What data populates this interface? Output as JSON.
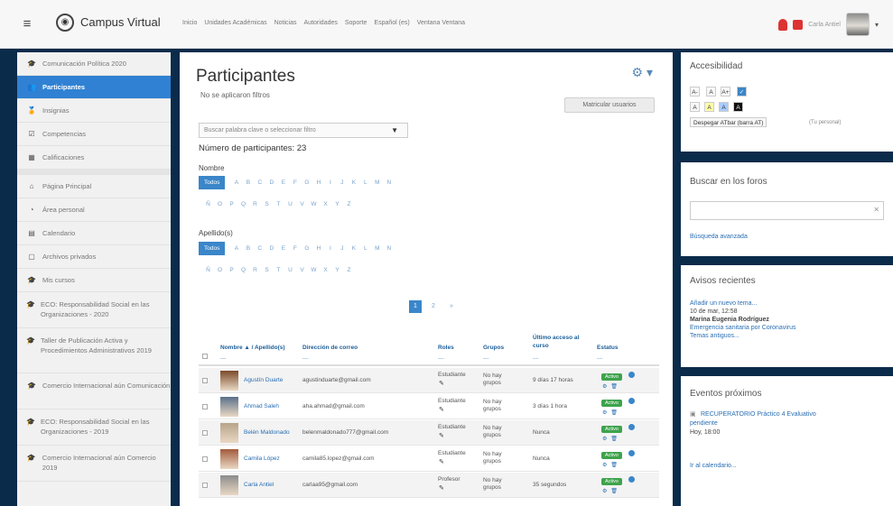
{
  "navbar": {
    "menu_icon": "hamburger-icon",
    "brand": "Campus Virtual",
    "links": [
      "Inicio",
      "Unidades Académicas",
      "Noticias",
      "Autoridades",
      "Soporte",
      "Español (es)",
      "Ventana Ventana"
    ],
    "user_name": "Carla Antiel",
    "chevron": "▾"
  },
  "drawer": {
    "items": [
      {
        "label": "Comunicación Política 2020",
        "icon": "graduation-cap-icon",
        "glyph": "🎓",
        "active": false
      },
      {
        "label": "Participantes",
        "icon": "users-icon",
        "glyph": "👥",
        "active": true
      },
      {
        "label": "Insignias",
        "icon": "badge-icon",
        "glyph": "🏅",
        "active": false
      },
      {
        "label": "Competencias",
        "icon": "competencies-icon",
        "glyph": "☑",
        "active": false
      },
      {
        "label": "Calificaciones",
        "icon": "grades-icon",
        "glyph": "▦",
        "active": false
      }
    ],
    "items2": [
      {
        "label": "Página Principal",
        "icon": "home-icon",
        "glyph": "⌂"
      },
      {
        "label": "Área personal",
        "icon": "dashboard-icon",
        "glyph": "◔"
      },
      {
        "label": "Calendario",
        "icon": "calendar-icon",
        "glyph": "▤"
      },
      {
        "label": "Archivos privados",
        "icon": "file-icon",
        "glyph": "▢"
      },
      {
        "label": "Mis cursos",
        "icon": "courses-icon",
        "glyph": "🎓"
      }
    ],
    "courses": [
      "ECO: Responsabilidad Social en las Organizaciones - 2020",
      "Taller de Publicación Activa y Procedimientos Administrativos 2019",
      "Comercio Internacional aún Comunicación",
      "ECO: Responsabilidad Social en las Organizaciones - 2019",
      "Comercio Internacional aún Comercio 2019"
    ]
  },
  "main": {
    "title": "Participantes",
    "filter_note": "No se aplicaron filtros",
    "enroll_button": "Matricular usuarios",
    "keyword_placeholder": "Buscar palabra clave o seleccionar filtro",
    "count": "Número de participantes: 23",
    "first_name_label": "Nombre",
    "last_name_label": "Apellido(s)",
    "all_label": "Todos",
    "letters_row1": [
      "A",
      "B",
      "C",
      "D",
      "E",
      "F",
      "G",
      "H",
      "I",
      "J",
      "K",
      "L",
      "M",
      "N"
    ],
    "letters_row2": [
      "Ñ",
      "O",
      "P",
      "Q",
      "R",
      "S",
      "T",
      "U",
      "V",
      "W",
      "X",
      "Y",
      "Z"
    ],
    "pages": [
      "1",
      "2",
      "»"
    ],
    "table": {
      "headers": {
        "name": "Nombre ▲ / Apellido(s)",
        "email": "Dirección de correo",
        "roles": "Roles",
        "groups": "Grupos",
        "last_access": "Último acceso al curso",
        "status": "Estatus"
      },
      "rows": [
        {
          "name": "Agustín Duarte",
          "email": "agustinduarte@gmail.com",
          "role": "Estudiante",
          "group": "No hay grupos",
          "access": "9 días 17 horas",
          "status": "Activo"
        },
        {
          "name": "Ahmad Saleh",
          "email": "aha.ahmad@gmail.com",
          "role": "Estudiante",
          "group": "No hay grupos",
          "access": "3 días 1 hora",
          "status": "Activo"
        },
        {
          "name": "Belén Maldonado",
          "email": "belenmaldonado777@gmail.com",
          "role": "Estudiante",
          "group": "No hay grupos",
          "access": "Nunca",
          "status": "Activo"
        },
        {
          "name": "Camila López",
          "email": "camila85.lopez@gmail.com",
          "role": "Estudiante",
          "group": "No hay grupos",
          "access": "Nunca",
          "status": "Activo"
        },
        {
          "name": "Carla Antiel",
          "email": "carlaa95@gmail.com",
          "role": "Profesor",
          "group": "No hay grupos",
          "access": "35 segundos",
          "status": "Activo"
        }
      ]
    }
  },
  "accessibility": {
    "title": "Accesibilidad",
    "size_buttons": [
      "A-",
      "A",
      "A+"
    ],
    "contrast_buttons": [
      "A",
      "A",
      "A",
      "A"
    ],
    "tts_button": "Despegar ATbar (barra AT)",
    "tts_note": "(Tu personal)"
  },
  "forum_search": {
    "title": "Buscar en los foros",
    "advanced": "Búsqueda avanzada"
  },
  "news": {
    "title": "Avisos recientes",
    "add": "Añadir un nuevo tema...",
    "date": "10 de mar, 12:58",
    "author": "Marina Eugenia Rodríguez",
    "topic": "Emergencia sanitaria por Coronavirus",
    "older": "Temas antiguos..."
  },
  "events": {
    "title": "Eventos próximos",
    "event": "RECUPERATORIO Práctico 4 Evaluativo",
    "event_status": "pendiente",
    "when": "Hoy, 18:00",
    "calendar_link": "Ir al calendario..."
  },
  "colors": {
    "primary": "#3081d3",
    "page_bg": "#0b2b4a",
    "status_green": "#3ea34c"
  }
}
